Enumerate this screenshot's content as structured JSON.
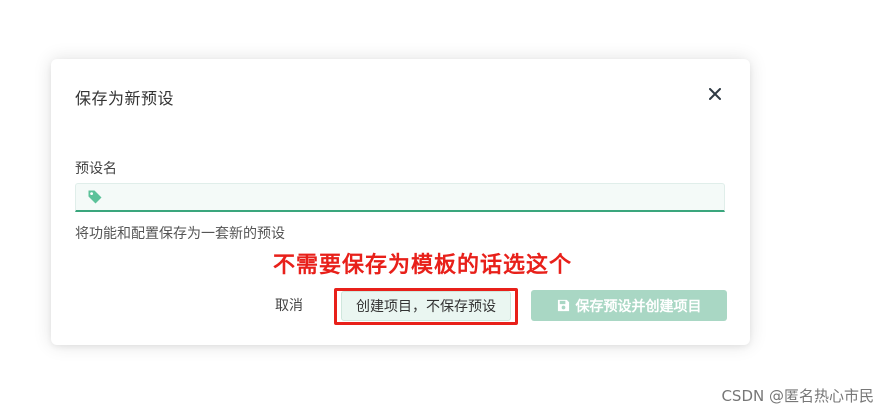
{
  "dialog": {
    "title": "保存为新预设",
    "close_icon": "close-icon",
    "field": {
      "label": "预设名",
      "value": "",
      "placeholder": "",
      "icon": "tag-icon",
      "accent_color": "#3aa67d"
    },
    "help_text": "将功能和配置保存为一套新的预设",
    "buttons": {
      "cancel_label": "取消",
      "create_without_save_label": "创建项目，不保存预设",
      "save_and_create_label": "保存预设并创建项目",
      "save_icon": "floppy-disk-icon"
    }
  },
  "annotation": {
    "text": "不需要保存为模板的话选这个",
    "color": "#e8201a"
  },
  "watermark": "CSDN @匿名热心市民"
}
